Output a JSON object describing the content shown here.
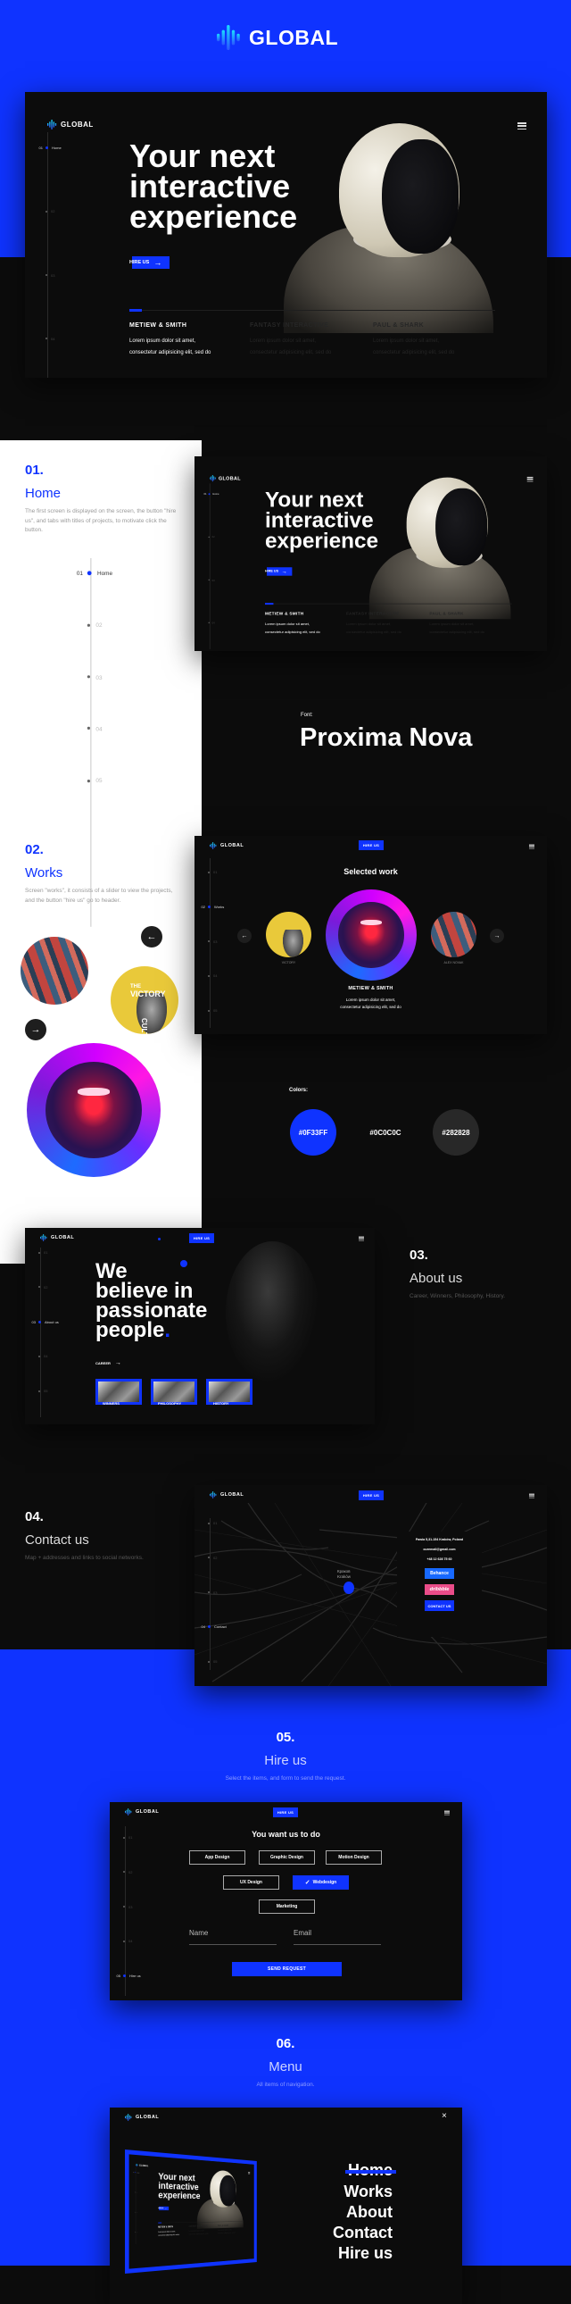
{
  "brand": {
    "name": "GLOBAL"
  },
  "colors": {
    "blue": "#0F33FF",
    "dark": "#0C0C0C",
    "gray": "#282828",
    "dribbble": "#EA4C89",
    "behance": "#1769FF"
  },
  "common": {
    "hire_us": "HIRE US"
  },
  "nav": {
    "numbers": [
      "01",
      "02",
      "03",
      "04",
      "05"
    ],
    "labels": [
      "Home",
      "Works",
      "About us",
      "Contact",
      "Hire us"
    ]
  },
  "hero": {
    "title_lines": [
      "Your next",
      "interactive",
      "experience"
    ],
    "cta": "HIRE US",
    "tabs": [
      {
        "title": "METIEW & SMITH",
        "text1": "Lorem ipsum dolor sit amet,",
        "text2": "consectetur adipisicing elit, sed do",
        "active": true
      },
      {
        "title": "FANTASY INTERACTIVE",
        "text1": "Lorem ipsum dolor sit amet,",
        "text2": "consectetur adipisicing elit, sed do",
        "active": false
      },
      {
        "title": "PAUL & SHARK",
        "text1": "Lorem ipsum dolor sit amet,",
        "text2": "consectetur adipisicing elit, sed do",
        "active": false
      }
    ]
  },
  "sections": [
    {
      "num": "01.",
      "title": "Home",
      "desc": "The first screen is displayed on the screen, the button \"hire us\", and tabs with titles of projects, to motivate click the button."
    },
    {
      "num": "02.",
      "title": "Works",
      "desc": "Screen \"works\", it consists of a slider to view the projects, and the button \"hire us\" go to header."
    },
    {
      "num": "03.",
      "title": "About us",
      "desc": "Career, Winners, Philosophy, History."
    },
    {
      "num": "04.",
      "title": "Contact us",
      "desc": "Map + addresses and links to social networks."
    },
    {
      "num": "05.",
      "title": "Hire us",
      "desc": "Select the items, and form to send the request."
    },
    {
      "num": "06.",
      "title": "Menu",
      "desc": "All items of navigation."
    }
  ],
  "font": {
    "label": "Font:",
    "name": "Proxima Nova"
  },
  "palette": {
    "label": "Colors:",
    "swatches": [
      "#0F33FF",
      "#0C0C0C",
      "#282828"
    ]
  },
  "works": {
    "title": "Selected work",
    "side_left": "VICTORY",
    "side_right": "ALEX NOVAK",
    "featured": {
      "title": "METIEW & SMITH",
      "text1": "Lorem ipsum dolor sit amet,",
      "text2": "consectetur adipisicing elit, sed do"
    },
    "poster": {
      "the": "THE",
      "victory": "VICTORY",
      "culture": "CULTURE"
    }
  },
  "about": {
    "title_lines": [
      "We",
      "believe in",
      "passionate",
      "people"
    ],
    "career": "CAREER",
    "thumbs": [
      "WINNERS",
      "PHILOSOPHY",
      "HISTORY"
    ]
  },
  "contact": {
    "address": "Pawia 5,31-154 Kraków, Poland",
    "email": "ouremail@gmail.com",
    "phone": "+48 12 628 75 60",
    "behance": "Behance",
    "dribbble": "dribbble",
    "cta": "CONTACT US",
    "map_label_1": "Краков",
    "map_label_2": "Kraków"
  },
  "hire": {
    "title": "You want us to do",
    "options": [
      {
        "label": "App Design",
        "selected": false
      },
      {
        "label": "Graphic Design",
        "selected": false
      },
      {
        "label": "Motion Design",
        "selected": false
      },
      {
        "label": "UX Design",
        "selected": false
      },
      {
        "label": "Webdesign",
        "selected": true
      },
      {
        "label": "Marketing",
        "selected": false
      }
    ],
    "name_placeholder": "Name",
    "email_placeholder": "Email",
    "submit": "SEND REQUEST"
  },
  "menu": {
    "items": [
      "Home",
      "Works",
      "About",
      "Contact",
      "Hire us"
    ],
    "active": "Home"
  }
}
